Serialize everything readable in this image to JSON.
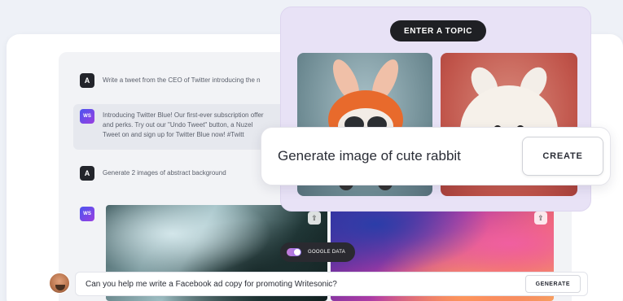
{
  "chat": {
    "messages": [
      {
        "avatar": "A",
        "text": "Write a tweet from the CEO of Twitter introducing the n"
      },
      {
        "avatar": "WS",
        "lines": [
          "Introducing Twitter Blue! Our first-ever subscription offer",
          "and perks. Try out our \"Undo Tweet\" button, a Nuzel",
          "Tweet on and sign up for Twitter Blue now! #Twitt"
        ]
      },
      {
        "avatar": "A",
        "text": "Generate 2 images of abstract background"
      },
      {
        "avatar": "WS",
        "text": ""
      }
    ],
    "download_icon": "download-icon"
  },
  "toggle": {
    "label": "GOOGLE DATA",
    "on": true
  },
  "prompt": {
    "text": "Can you help me write a Facebook ad copy for promoting Writesonic?",
    "button": "GENERATE"
  },
  "topic_card": {
    "pill": "ENTER A TOPIC",
    "generate_text": "Generate image of cute rabbit",
    "create_button": "CREATE"
  },
  "colors": {
    "accent_purple": "#e8e2f6",
    "dark": "#1f2024",
    "ws_gradient_start": "#4b54f0",
    "ws_gradient_end": "#9a3fe0"
  }
}
